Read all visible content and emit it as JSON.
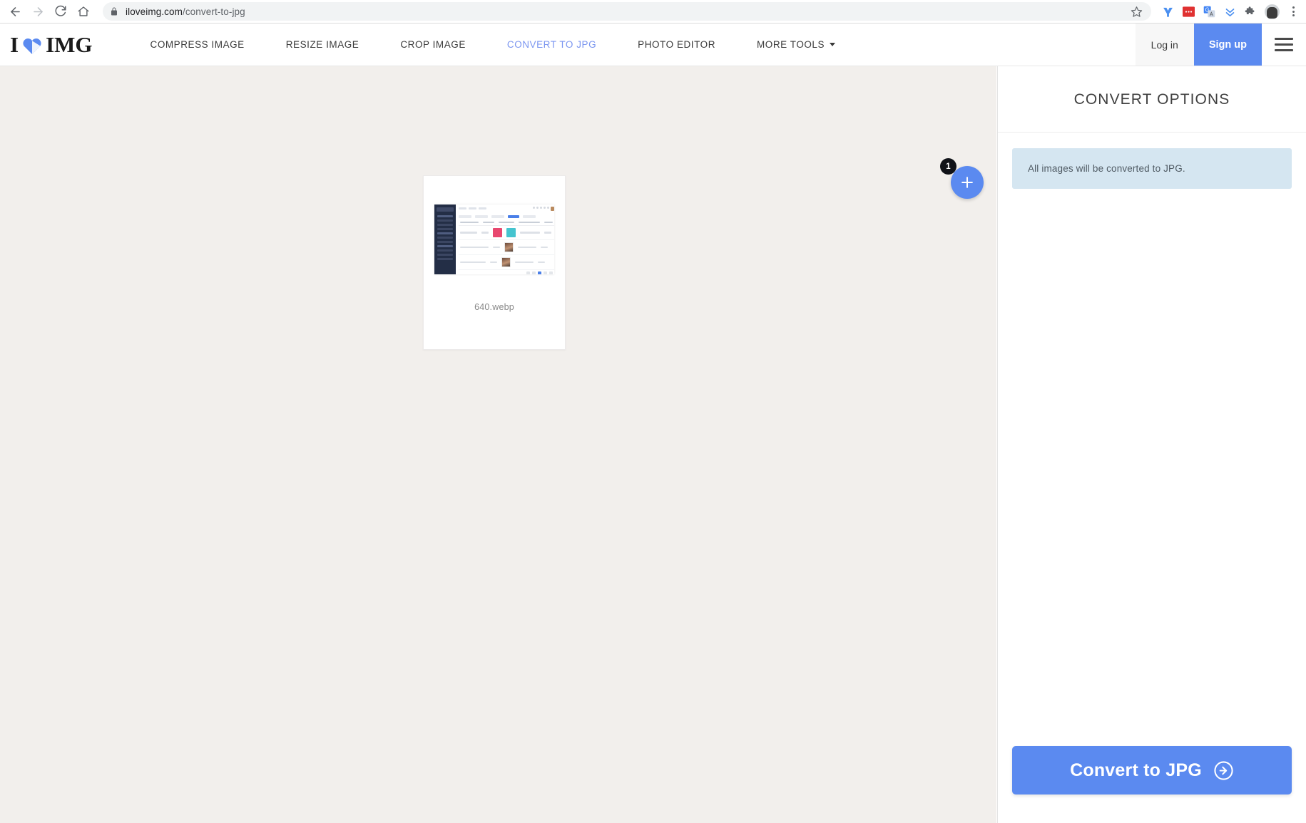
{
  "browser": {
    "url_host": "iloveimg.com",
    "url_path": "/convert-to-jpg",
    "back_icon": "back-arrow-icon",
    "forward_icon": "forward-arrow-icon",
    "reload_icon": "reload-icon",
    "home_icon": "home-icon",
    "lock_icon": "lock-icon",
    "bookmark_icon": "star-icon",
    "extensions": [
      "yandex-extension-icon",
      "red-dots-extension-icon",
      "google-translate-icon",
      "downloads-chevrons-icon",
      "puzzle-extensions-icon"
    ],
    "profile_icon": "profile-avatar-icon",
    "menu_icon": "three-dots-menu-icon"
  },
  "header": {
    "logo_pre": "I",
    "logo_post": "IMG",
    "logo_heart_color": "#5b8af0",
    "nav": [
      {
        "label": "COMPRESS IMAGE",
        "active": false
      },
      {
        "label": "RESIZE IMAGE",
        "active": false
      },
      {
        "label": "CROP IMAGE",
        "active": false
      },
      {
        "label": "CONVERT TO JPG",
        "active": true
      },
      {
        "label": "PHOTO EDITOR",
        "active": false
      },
      {
        "label": "MORE TOOLS",
        "active": false,
        "has_caret": true
      }
    ],
    "login_label": "Log in",
    "signup_label": "Sign up",
    "accent_color": "#5b8af0",
    "active_nav_color": "#7b96f0"
  },
  "workspace": {
    "background_color": "#f2efec",
    "file": {
      "name": "640.webp",
      "thumbnail": "dashboard-screenshot-thumbnail"
    },
    "add_button": {
      "icon": "plus-icon",
      "badge_count": "1",
      "color": "#5b8af0"
    }
  },
  "panel": {
    "title": "CONVERT OPTIONS",
    "info_message": "All images will be converted to JPG.",
    "info_box_color": "#d5e6f1",
    "convert_button": {
      "label": "Convert to JPG",
      "icon": "arrow-right-circle-icon",
      "color": "#5b8af0"
    }
  }
}
